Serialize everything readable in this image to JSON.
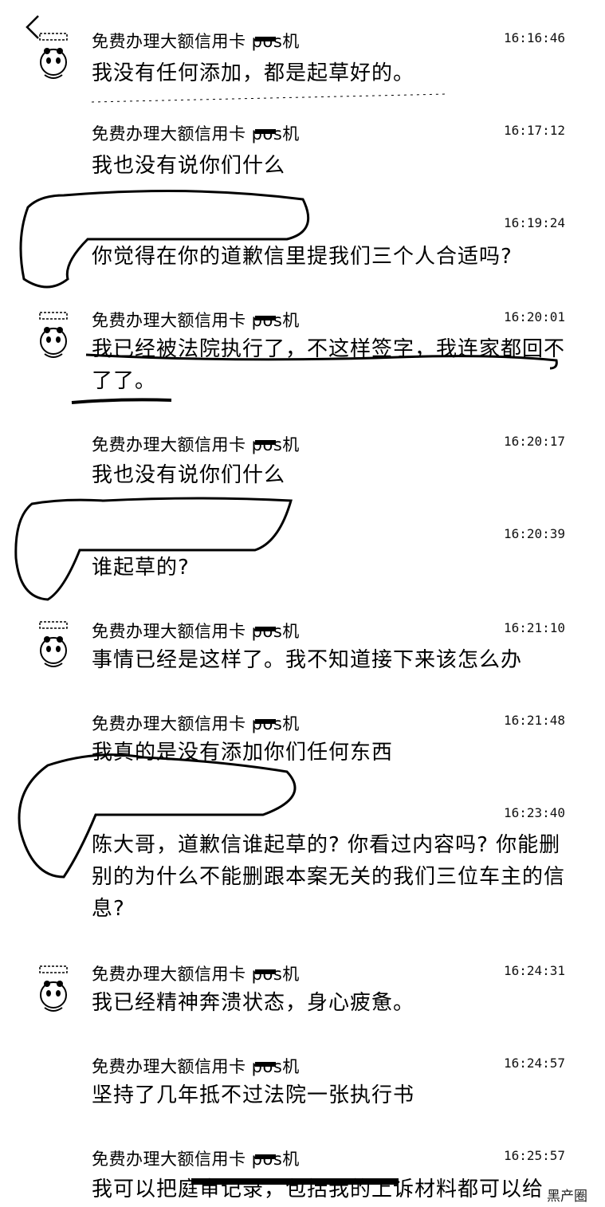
{
  "nav": {
    "back_icon": "chevron-left-icon"
  },
  "messages": [
    {
      "sender": "免费办理大额信用卡 pos机",
      "time": "16:16:46",
      "text": "我没有任何添加，都是起草好的。",
      "avatar": true
    },
    {
      "sender": "免费办理大额信用卡 pos机",
      "time": "16:17:12",
      "text": "我也没有说你们什么",
      "avatar": false
    },
    {
      "sender": "",
      "time": "16:19:24",
      "text": "你觉得在你的道歉信里提我们三个人合适吗?",
      "avatar": false
    },
    {
      "sender": "免费办理大额信用卡 pos机",
      "time": "16:20:01",
      "text": "我已经被法院执行了，不这样签字，我连家都回不了了。",
      "avatar": true
    },
    {
      "sender": "免费办理大额信用卡 pos机",
      "time": "16:20:17",
      "text": "我也没有说你们什么",
      "avatar": false
    },
    {
      "sender": "",
      "time": "16:20:39",
      "text": "谁起草的?",
      "avatar": false
    },
    {
      "sender": "免费办理大额信用卡 pos机",
      "time": "16:21:10",
      "text": "事情已经是这样了。我不知道接下来该怎么办",
      "avatar": true
    },
    {
      "sender": "免费办理大额信用卡 pos机",
      "time": "16:21:48",
      "text": "我真的是没有添加你们任何东西",
      "avatar": false
    },
    {
      "sender": "",
      "time": "16:23:40",
      "text": "陈大哥，道歉信谁起草的? 你看过内容吗? 你能删别的为什么不能删跟本案无关的我们三位车主的信息?",
      "avatar": false
    },
    {
      "sender": "免费办理大额信用卡 pos机",
      "time": "16:24:31",
      "text": "我已经精神奔溃状态，身心疲惫。",
      "avatar": true
    },
    {
      "sender": "免费办理大额信用卡 pos机",
      "time": "16:24:57",
      "text": "坚持了几年抵不过法院一张执行书",
      "avatar": false
    },
    {
      "sender": "免费办理大额信用卡 pos机",
      "time": "16:25:57",
      "text": "我可以把庭审记录，包括我的上诉材料都可以给",
      "avatar": false
    }
  ],
  "watermark": "黑产圈"
}
